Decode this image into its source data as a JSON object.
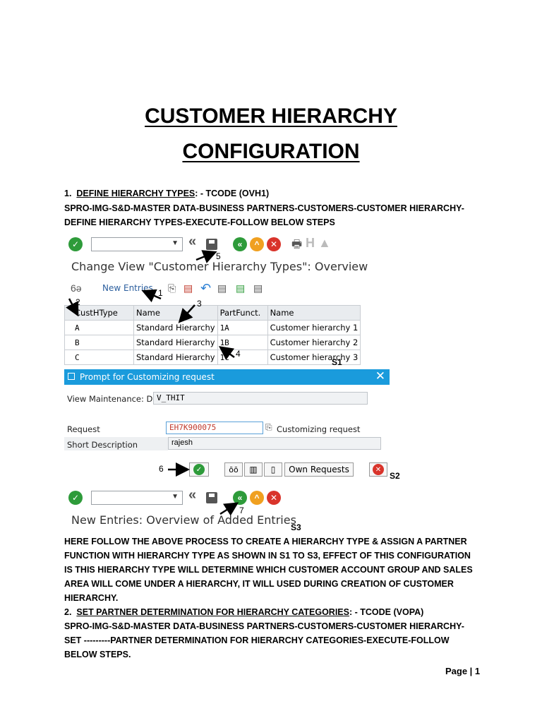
{
  "doc": {
    "title_line1": "CUSTOMER HIERARCHY",
    "title_line2": "CONFIGURATION",
    "section1": {
      "num": "1.",
      "heading": "DEFINE HIERARCHY TYPES",
      "tcode": ": - TCODE (OVH1)",
      "path": "SPRO-IMG-S&D-MASTER DATA-BUSINESS PARTNERS-CUSTOMERS-CUSTOMER HIERARCHY-DEFINE HIERARCHY TYPES-EXECUTE-FOLLOW BELOW STEPS"
    },
    "explanation": "HERE FOLLOW THE ABOVE PROCESS TO CREATE A HIERARCHY TYPE & ASSIGN A PARTNER FUNCTION WITH HIERARCHY TYPE AS SHOWN IN S1 TO S3, EFFECT OF THIS CONFIGURATION IS THIS HIERARCHY TYPE WILL DETERMINE WHICH CUSTOMER ACCOUNT GROUP AND SALES AREA WILL COME UNDER A HIERARCHY, IT WILL USED DURING CREATION OF CUSTOMER HIERARCHY.",
    "section2": {
      "num": "2.",
      "heading": "SET PARTNER DETERMINATION FOR HIERARCHY CATEGORIES",
      "tcode": ": - TCODE (VOPA)",
      "path": "SPRO-IMG-S&D-MASTER DATA-BUSINESS PARTNERS-CUSTOMERS-CUSTOMER HIERARCHY-SET ---------PARTNER DETERMINATION FOR HIERARCHY CATEGORIES-EXECUTE-FOLLOW BELOW STEPS."
    },
    "footer": "Page | 1",
    "labels": {
      "s1": "S1",
      "s2": "S2",
      "s3": "S3"
    },
    "markers": {
      "m1": "1",
      "m2": "2",
      "m3": "3",
      "m4": "4",
      "m5": "5",
      "m6": "6",
      "m7": "7"
    }
  },
  "screen1": {
    "title": "Change View \"Customer Hierarchy Types\": Overview",
    "new_entries": "New Entries",
    "columns": [
      "CustHType",
      "Name",
      "PartFunct.",
      "Name"
    ],
    "rows": [
      [
        "A",
        "Standard Hierarchy",
        "1A",
        "Customer hierarchy 1"
      ],
      [
        "B",
        "Standard Hierarchy",
        "1B",
        "Customer hierarchy 2"
      ],
      [
        "C",
        "Standard Hierarchy",
        "1C",
        "Customer hierarchy 3"
      ]
    ]
  },
  "screen2": {
    "title": "Prompt for Customizing request",
    "close": "✕",
    "view_maintenance_label": "View Maintenance: D...",
    "view_maintenance_value": "V_THIT",
    "request_label": "Request",
    "request_value": "EH7K900075",
    "customizing_request": "Customizing request",
    "short_desc_label": "Short Description",
    "short_desc_value": "rajesh",
    "own_requests": "Own Requests"
  },
  "screen3": {
    "title": "New Entries: Overview of Added Entries"
  },
  "colors": {
    "green": "#2e9b3a",
    "orange": "#f0a020",
    "red": "#d9342b",
    "blue_bar": "#1a9bdc"
  }
}
